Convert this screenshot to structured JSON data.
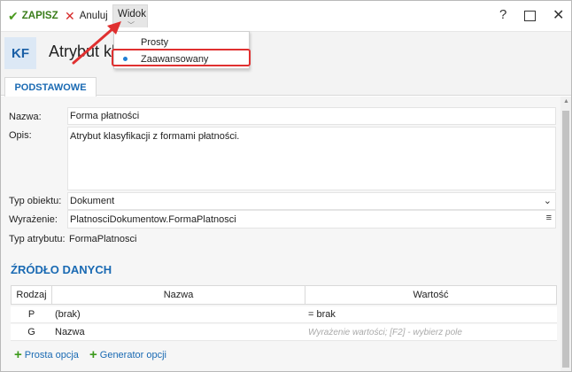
{
  "toolbar": {
    "save_label": "ZAPISZ",
    "cancel_label": "Anuluj",
    "view_label": "Widok"
  },
  "window_controls": {
    "help": "?",
    "maximize": "",
    "close": "✕"
  },
  "header": {
    "badge": "KF",
    "title": "Atrybut klasyfikacji"
  },
  "view_menu": {
    "items": [
      {
        "label": "Prosty",
        "selected": false
      },
      {
        "label": "Zaawansowany",
        "selected": true
      }
    ]
  },
  "tabs": [
    {
      "label": "PODSTAWOWE",
      "active": true
    }
  ],
  "form": {
    "name_label": "Nazwa:",
    "name_value": "Forma płatności",
    "desc_label": "Opis:",
    "desc_value": "Atrybut klasyfikacji z formami płatności.",
    "type_label": "Typ obiektu:",
    "type_value": "Dokument",
    "expr_label": "Wyrażenie:",
    "expr_value": "PlatnosciDokumentow.FormaPlatnosci",
    "attr_type_label": "Typ atrybutu:",
    "attr_type_value": "FormaPlatnosci"
  },
  "datasource": {
    "title": "ŹRÓDŁO DANYCH",
    "columns": [
      "Rodzaj",
      "Nazwa",
      "Wartość"
    ],
    "rows": [
      {
        "kind": "P",
        "name": "(brak)",
        "value": "= brak"
      },
      {
        "kind": "G",
        "name": "Nazwa",
        "value_placeholder": "Wyrażenie wartości; [F2] - wybierz pole"
      }
    ]
  },
  "actions": {
    "simple_option": "Prosta opcja",
    "option_generator": "Generator opcji"
  },
  "colors": {
    "accent": "#1a6ab3",
    "save_green": "#4a9a1e",
    "cancel_red": "#d62a2a",
    "highlight_red": "#e03030"
  },
  "icons": [
    "check-icon",
    "x-icon",
    "chevron-down-icon",
    "help-icon",
    "maximize-icon",
    "close-icon",
    "dropdown-arrow-icon",
    "ellipsis-menu-icon",
    "plus-icon",
    "radio-dot-icon",
    "annotation-arrow-icon"
  ]
}
